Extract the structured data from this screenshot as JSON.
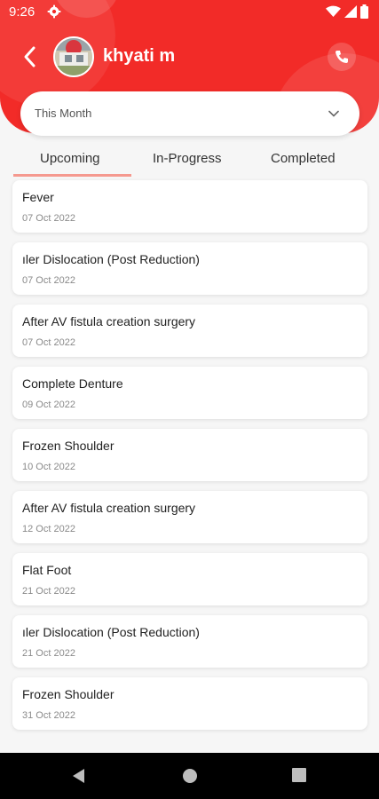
{
  "status_bar": {
    "time": "9:26"
  },
  "header": {
    "patient_name": "khyati m"
  },
  "filter": {
    "period": "This Month"
  },
  "tabs": [
    {
      "label": "Upcoming",
      "active": true
    },
    {
      "label": "In-Progress",
      "active": false
    },
    {
      "label": "Completed",
      "active": false
    }
  ],
  "appointments": [
    {
      "title": "Fever",
      "date": "07 Oct 2022"
    },
    {
      "title": "ıler Dislocation (Post Reduction)",
      "date": "07 Oct 2022"
    },
    {
      "title": "After AV fistula creation surgery",
      "date": "07 Oct 2022"
    },
    {
      "title": "Complete Denture",
      "date": "09 Oct 2022"
    },
    {
      "title": "Frozen Shoulder",
      "date": "10 Oct 2022"
    },
    {
      "title": "After AV fistula creation surgery",
      "date": "12 Oct 2022"
    },
    {
      "title": "Flat Foot",
      "date": "21 Oct 2022"
    },
    {
      "title": "ıler Dislocation (Post Reduction)",
      "date": "21 Oct 2022"
    },
    {
      "title": "Frozen Shoulder",
      "date": "31 Oct 2022"
    }
  ],
  "colors": {
    "primary": "#f22b28",
    "tab_indicator": "#f5998f",
    "background": "#f6f6f6"
  },
  "icons": [
    "settings-icon",
    "wifi-icon",
    "signal-icon",
    "battery-icon",
    "back-arrow-icon",
    "phone-icon",
    "chevron-down-icon",
    "nav-back-icon",
    "nav-home-icon",
    "nav-recents-icon"
  ]
}
